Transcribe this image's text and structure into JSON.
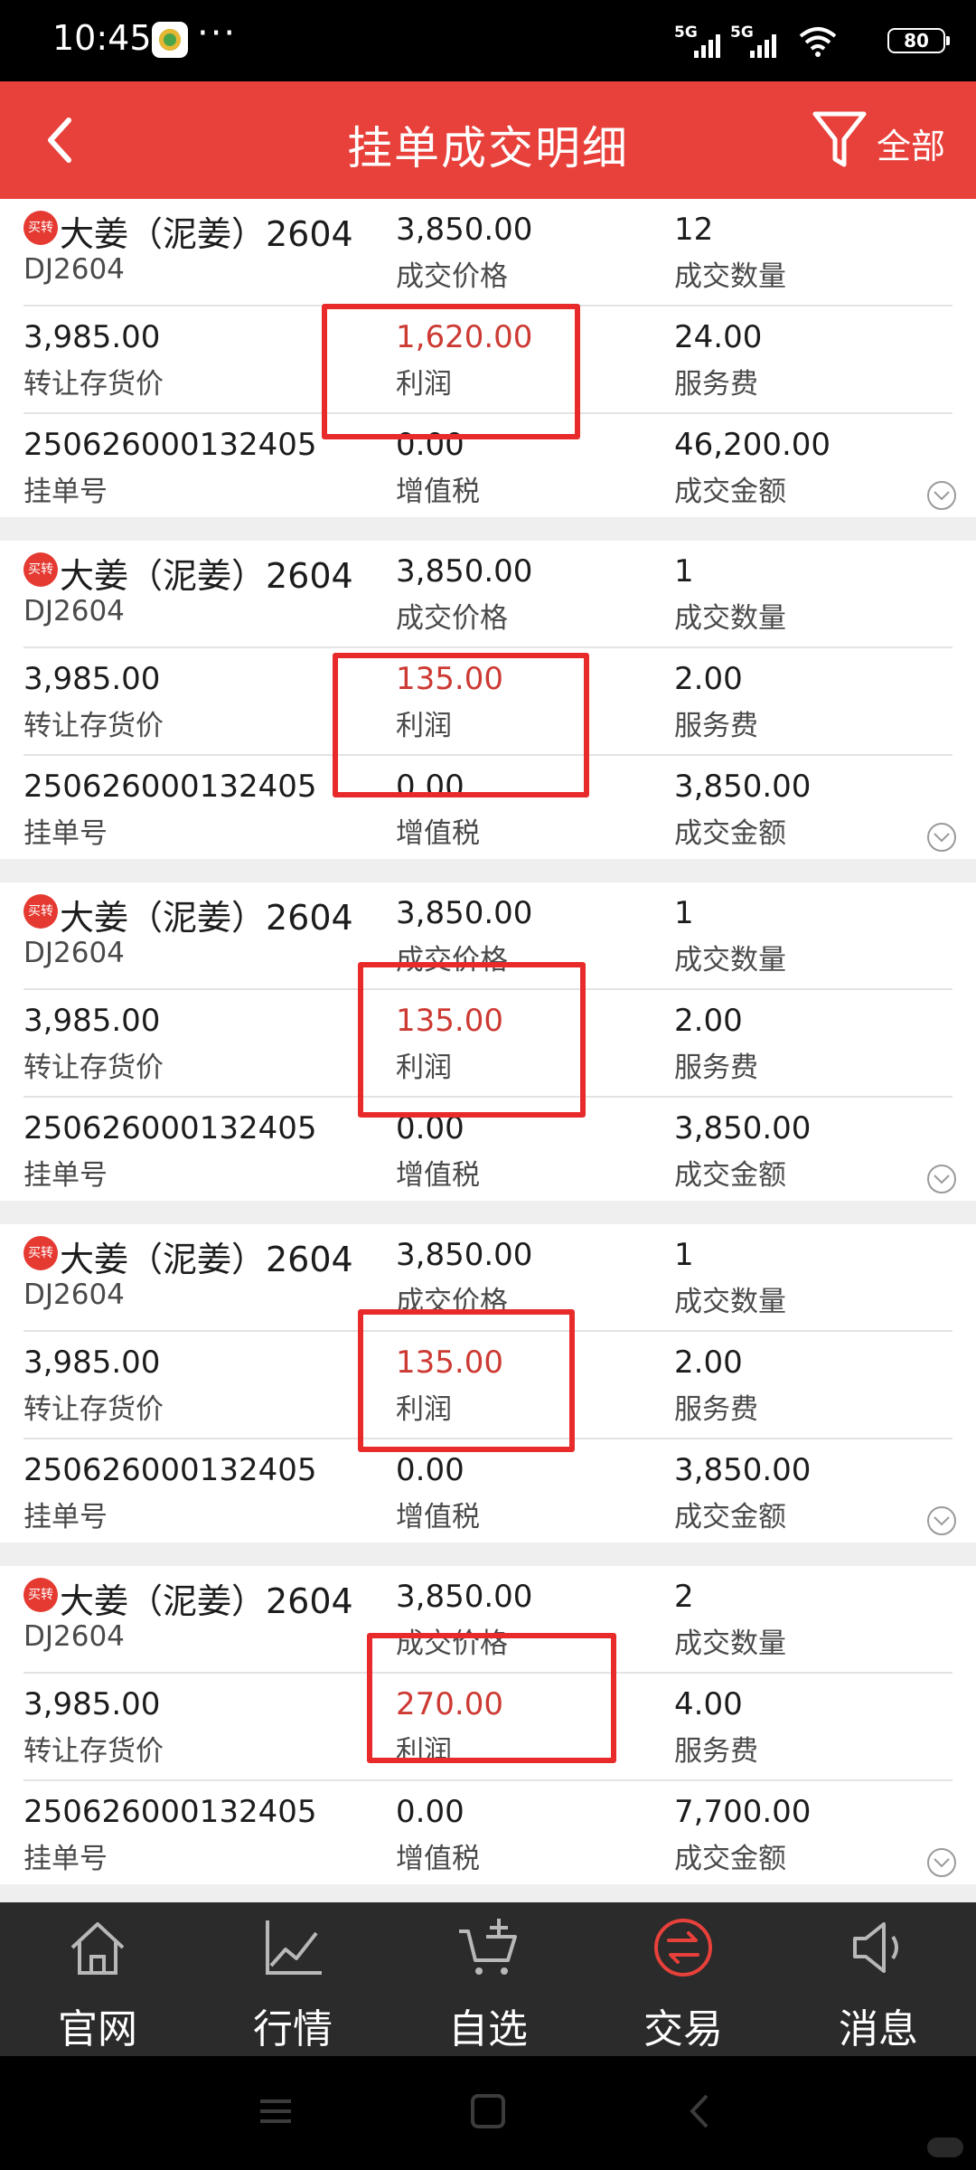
{
  "status_bar": {
    "time": "10:45",
    "dots": "···",
    "signal_1": "5G",
    "signal_2": "5G",
    "battery": "80"
  },
  "header": {
    "title": "挂单成交明细",
    "filter_label": "全部",
    "background_color": "#e8403a"
  },
  "labels": {
    "price": "成交价格",
    "quantity": "成交数量",
    "transfer_price": "转让存货价",
    "profit": "利润",
    "service_fee": "服务费",
    "order_no": "挂单号",
    "vat": "增值税",
    "amount": "成交金额",
    "badge": "买转"
  },
  "records": [
    {
      "name": "大姜（泥姜）2604",
      "code": "DJ2604",
      "price": "3,850.00",
      "quantity": "12",
      "transfer_price": "3,985.00",
      "profit": "1,620.00",
      "service_fee": "24.00",
      "order_no": "250626000132405",
      "vat": "0.00",
      "amount": "46,200.00"
    },
    {
      "name": "大姜（泥姜）2604",
      "code": "DJ2604",
      "price": "3,850.00",
      "quantity": "1",
      "transfer_price": "3,985.00",
      "profit": "135.00",
      "service_fee": "2.00",
      "order_no": "250626000132405",
      "vat": "0.00",
      "amount": "3,850.00"
    },
    {
      "name": "大姜（泥姜）2604",
      "code": "DJ2604",
      "price": "3,850.00",
      "quantity": "1",
      "transfer_price": "3,985.00",
      "profit": "135.00",
      "service_fee": "2.00",
      "order_no": "250626000132405",
      "vat": "0.00",
      "amount": "3,850.00"
    },
    {
      "name": "大姜（泥姜）2604",
      "code": "DJ2604",
      "price": "3,850.00",
      "quantity": "1",
      "transfer_price": "3,985.00",
      "profit": "135.00",
      "service_fee": "2.00",
      "order_no": "250626000132405",
      "vat": "0.00",
      "amount": "3,850.00"
    },
    {
      "name": "大姜（泥姜）2604",
      "code": "DJ2604",
      "price": "3,850.00",
      "quantity": "2",
      "transfer_price": "3,985.00",
      "profit": "270.00",
      "service_fee": "4.00",
      "order_no": "250626000132405",
      "vat": "0.00",
      "amount": "7,700.00"
    }
  ],
  "bottom_nav": [
    {
      "label": "官网",
      "icon": "home-icon",
      "active": false
    },
    {
      "label": "行情",
      "icon": "line-chart-icon",
      "active": false
    },
    {
      "label": "自选",
      "icon": "cart-add-icon",
      "active": false
    },
    {
      "label": "交易",
      "icon": "exchange-icon",
      "active": true
    },
    {
      "label": "消息",
      "icon": "speaker-icon",
      "active": false
    }
  ],
  "colors": {
    "accent": "#e8403a",
    "profit_text": "#cc3a33",
    "highlight_box": "#e82a2a",
    "nav_background": "#2b2b2b"
  }
}
